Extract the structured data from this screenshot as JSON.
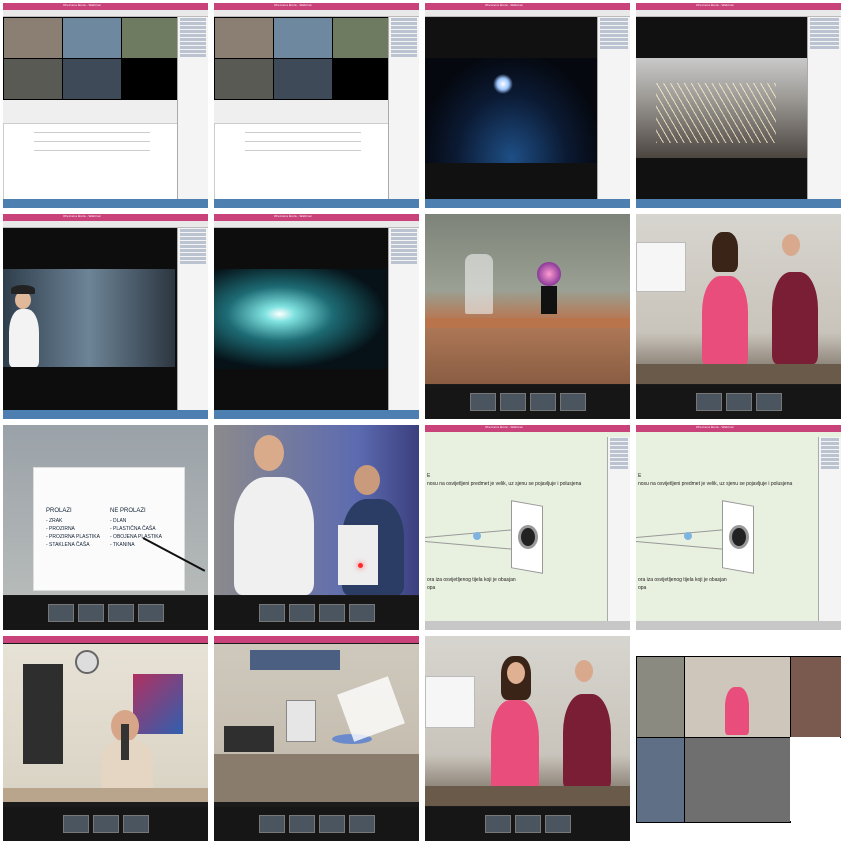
{
  "window_title": "Otvorena škola - Webinar",
  "grid": [
    {
      "id": "t1",
      "kind": "webinar-cams"
    },
    {
      "id": "t2",
      "kind": "webinar-cams"
    },
    {
      "id": "t3",
      "kind": "video-earth"
    },
    {
      "id": "t4",
      "kind": "video-rock"
    },
    {
      "id": "t5",
      "kind": "video-boy"
    },
    {
      "id": "t6",
      "kind": "video-galaxy"
    },
    {
      "id": "t7",
      "kind": "live-plasma"
    },
    {
      "id": "t8",
      "kind": "live-girls"
    },
    {
      "id": "t9",
      "kind": "live-poster"
    },
    {
      "id": "t10",
      "kind": "live-laser"
    },
    {
      "id": "t11",
      "kind": "slide-shadow"
    },
    {
      "id": "t12",
      "kind": "slide-shadow"
    },
    {
      "id": "t13",
      "kind": "live-microscope"
    },
    {
      "id": "t14",
      "kind": "live-lab"
    },
    {
      "id": "t15",
      "kind": "live-girls"
    },
    {
      "id": "t16",
      "kind": "live-classroom"
    }
  ],
  "poster": {
    "left_title": "PROLAZI",
    "left_items": [
      "- ZRAK",
      "- PROZIRNA",
      "- PROZIRNA PLASTIKA",
      "- STAKLENA ČAŠA"
    ],
    "right_title": "NE PROLAZI",
    "right_items": [
      "- DLAN",
      "- PLASTIČNA ČAŠA",
      "- OBOJENA PLASTIKA",
      "- TKANINA"
    ]
  },
  "slide": {
    "line1": "nosu na osvijetljeni predmet je velik, uz sjenu se pojavljuje i polusjena",
    "line2": "ora iza osvijetljenog tijela koji je obasjan",
    "line3": "opa",
    "corner": "E"
  },
  "colors": {
    "titlebar": "#c9437a",
    "taskbar": "#4d7fb0",
    "slide_bg": "#e8f0df",
    "shirt_pink": "#e94d7c",
    "shirt_maroon": "#7a1e35"
  }
}
